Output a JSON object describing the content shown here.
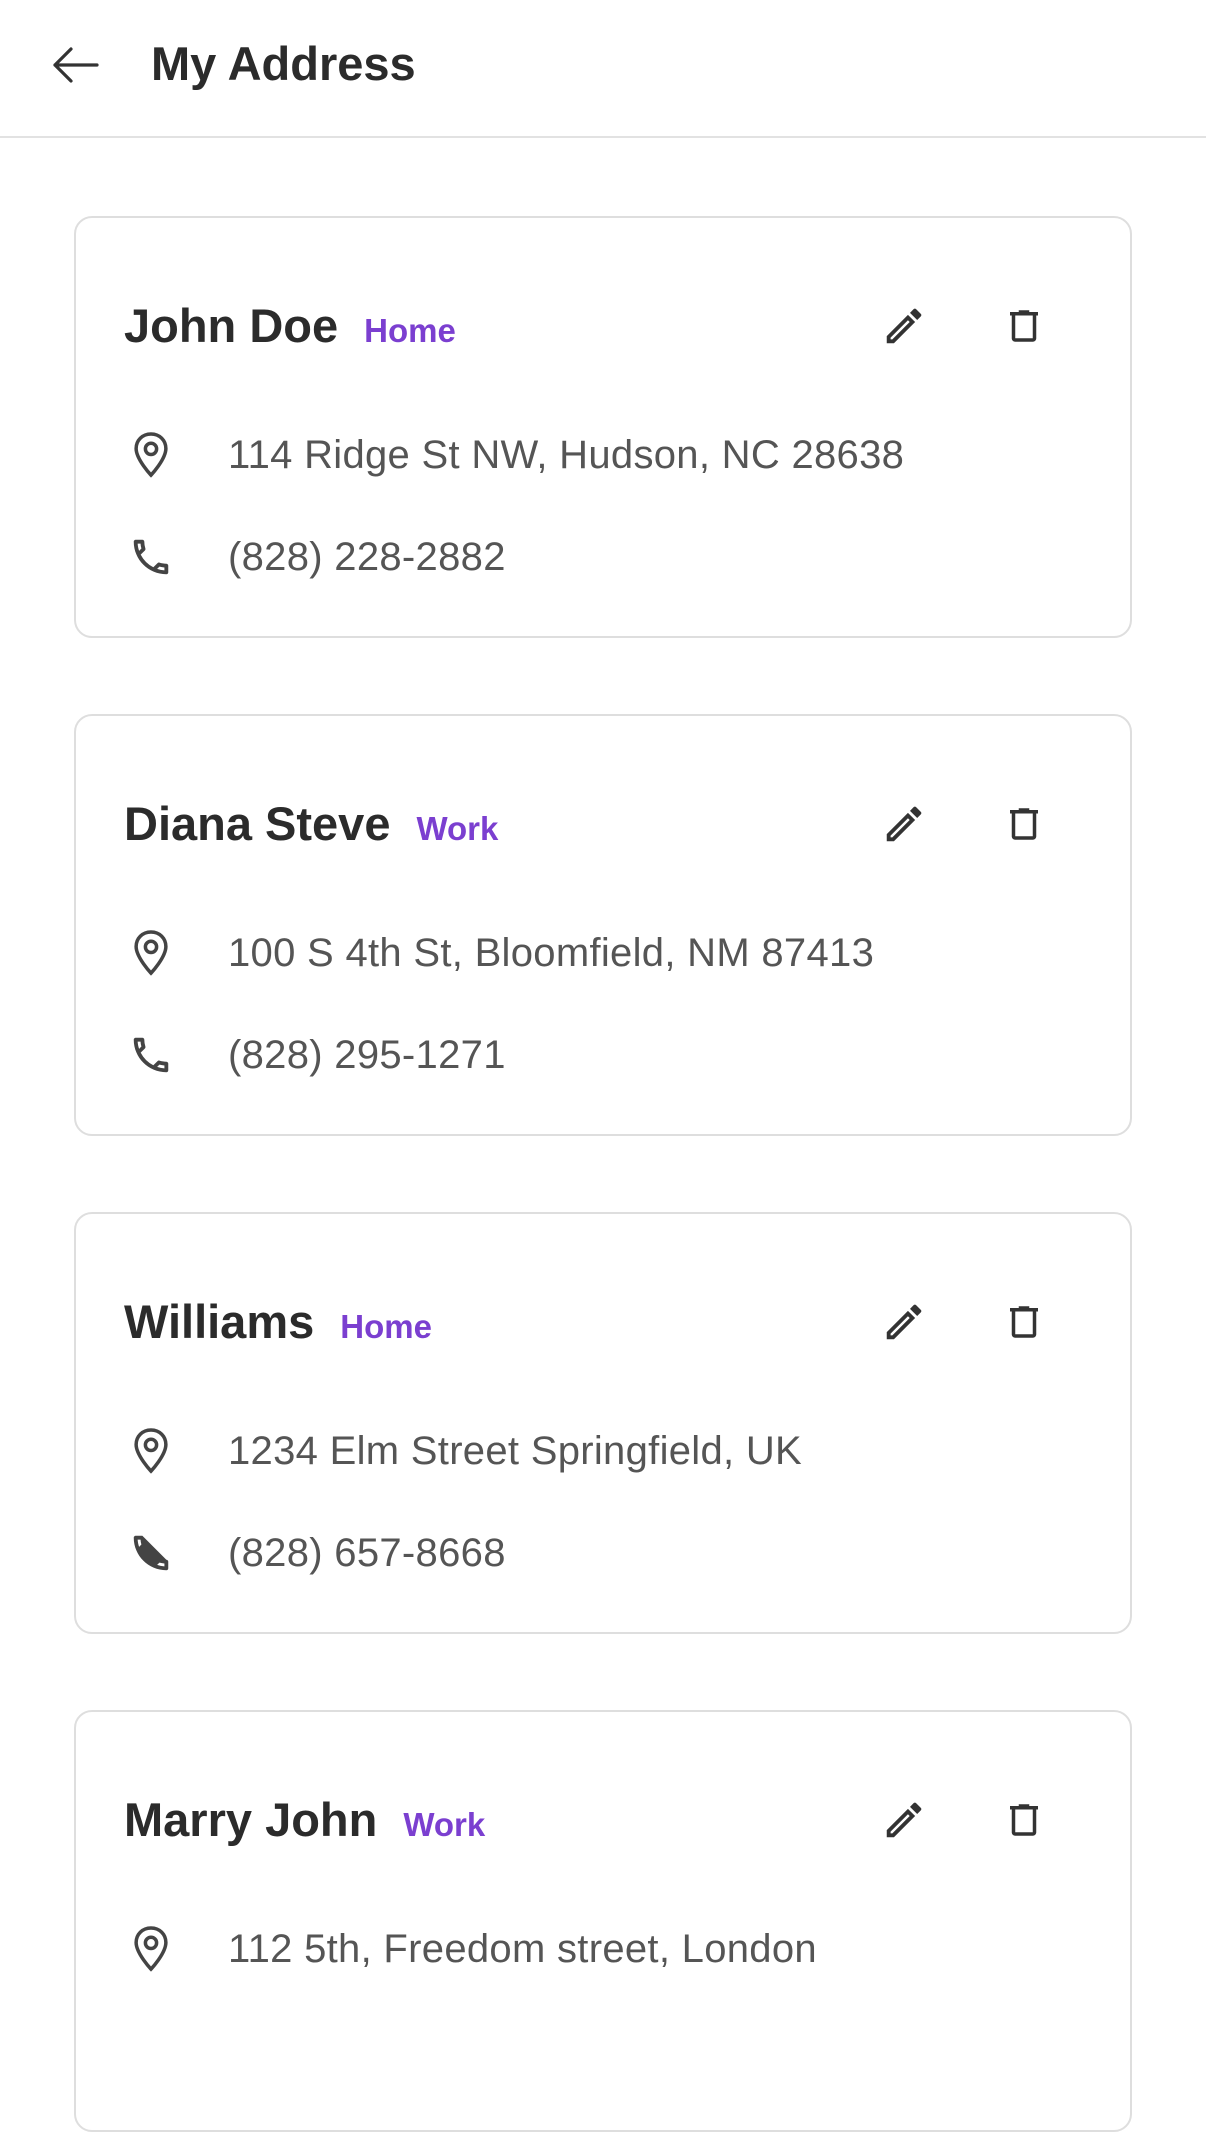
{
  "header": {
    "title": "My Address",
    "back_icon": "arrow-left-icon"
  },
  "colors": {
    "tag": "#7b3fd0",
    "text": "#2b2b2b",
    "secondary_text": "#555555",
    "border": "#dedede"
  },
  "addresses": [
    {
      "name": "John Doe",
      "tag": "Home",
      "address": "114 Ridge St NW, Hudson, NC 28638",
      "phone": "(828) 228-2882"
    },
    {
      "name": "Diana Steve",
      "tag": "Work",
      "address": "100 S 4th St, Bloomfield, NM 87413",
      "phone": "(828) 295-1271"
    },
    {
      "name": "Williams",
      "tag": "Home",
      "address": "1234 Elm Street Springfield, UK",
      "phone": "(828) 657-8668"
    },
    {
      "name": "Marry John",
      "tag": "Work",
      "address": "112  5th, Freedom street, London",
      "phone": ""
    }
  ],
  "icons": {
    "edit": "pencil-icon",
    "delete": "trash-icon",
    "address": "location-pin-icon",
    "phone": "phone-icon"
  }
}
